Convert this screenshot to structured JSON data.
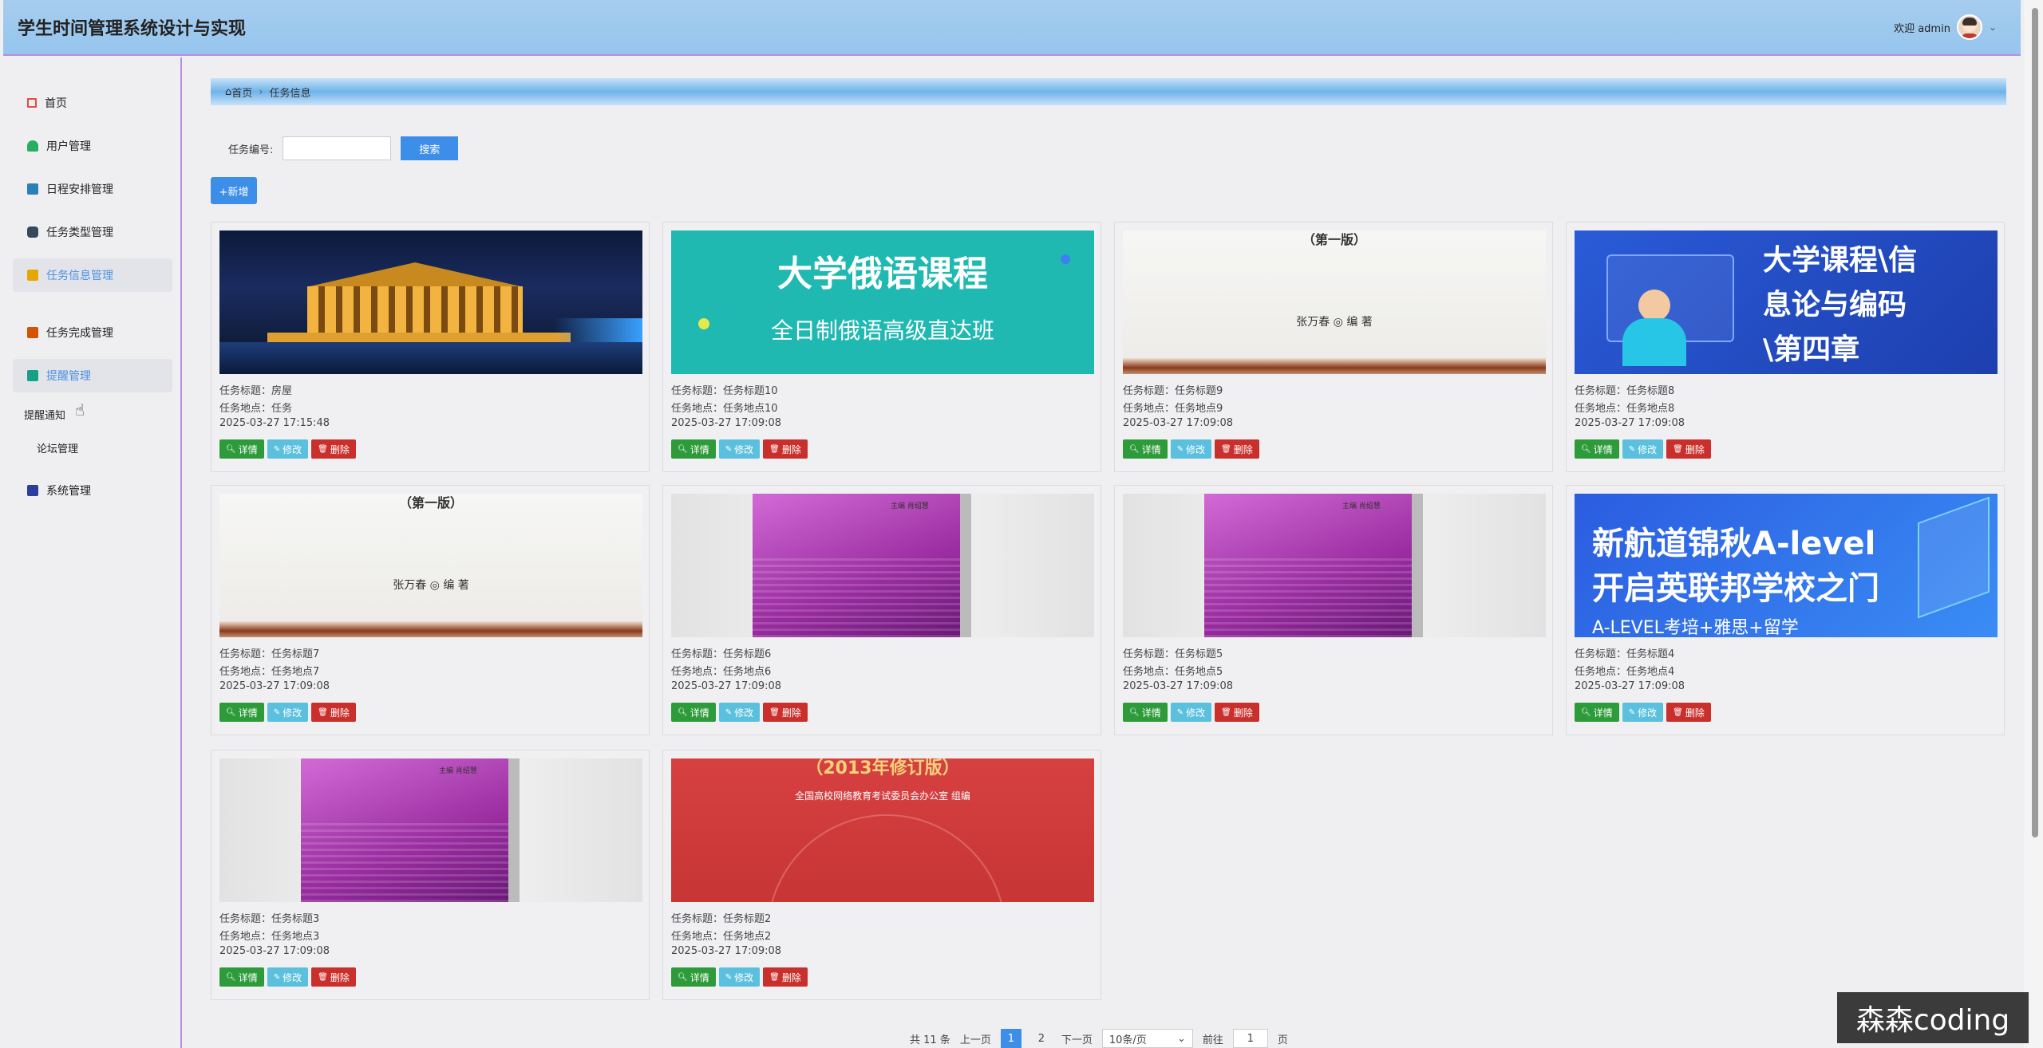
{
  "app": {
    "title": "学生时间管理系统设计与实现"
  },
  "user": {
    "greeting": "欢迎 admin"
  },
  "sidebar": {
    "items": [
      {
        "label": "首页",
        "icon": "home-icon",
        "color": "#e74c3c"
      },
      {
        "label": "用户管理",
        "icon": "user-icon",
        "color": "#27ae60"
      },
      {
        "label": "日程安排管理",
        "icon": "schedule-icon",
        "color": "#2980b9"
      },
      {
        "label": "任务类型管理",
        "icon": "type-icon",
        "color": "#34495e"
      },
      {
        "label": "任务信息管理",
        "icon": "info-icon",
        "color": "#e5a800"
      },
      {
        "label": "任务完成管理",
        "icon": "complete-icon",
        "color": "#d35400"
      },
      {
        "label": "提醒管理",
        "icon": "reminder-icon",
        "color": "#16a085"
      },
      {
        "label": "系统管理",
        "icon": "system-icon",
        "color": "#2c3e9b"
      }
    ],
    "sub_items": [
      "提醒通知",
      "论坛管理"
    ]
  },
  "breadcrumb": {
    "home": "首页",
    "current": "任务信息"
  },
  "search": {
    "label": "任务编号:",
    "button": "搜索"
  },
  "add_button": "新增",
  "card_labels": {
    "title_prefix": "任务标题：",
    "location_prefix": "任务地点：",
    "detail": "详情",
    "edit": "修改",
    "delete": "删除"
  },
  "cards": [
    {
      "title": "房屋",
      "location": "任务",
      "time": "2025-03-27 17:15:48",
      "image": "night-temple"
    },
    {
      "title": "任务标题10",
      "location": "任务地点10",
      "time": "2025-03-27 17:09:08",
      "image": "russian-course",
      "img_text1": "大学俄语课程",
      "img_text2": "全日制俄语高级直达班"
    },
    {
      "title": "任务标题9",
      "location": "任务地点9",
      "time": "2025-03-27 17:09:08",
      "image": "book-cover-white",
      "img_text1": "（第一版）",
      "img_text2": "张万春 ◎ 编 著"
    },
    {
      "title": "任务标题8",
      "location": "任务地点8",
      "time": "2025-03-27 17:09:08",
      "image": "coding-course",
      "img_text1": "大学课程\\信",
      "img_text2": "息论与编码",
      "img_text3": "\\第四章"
    },
    {
      "title": "任务标题7",
      "location": "任务地点7",
      "time": "2025-03-27 17:09:08",
      "image": "book-cover-white",
      "img_text1": "（第一版）",
      "img_text2": "张万春 ◎ 编 著"
    },
    {
      "title": "任务标题6",
      "location": "任务地点6",
      "time": "2025-03-27 17:09:08",
      "image": "purple-book",
      "img_text1": "主编 肖绍慧"
    },
    {
      "title": "任务标题5",
      "location": "任务地点5",
      "time": "2025-03-27 17:09:08",
      "image": "purple-book",
      "img_text1": "主编 肖绍慧"
    },
    {
      "title": "任务标题4",
      "location": "任务地点4",
      "time": "2025-03-27 17:09:08",
      "image": "alevel-ad",
      "img_text1": "新航道锦秋A-level",
      "img_text2": "开启英联邦学校之门",
      "img_text3": "A-LEVEL考培+雅思+留学"
    },
    {
      "title": "任务标题3",
      "location": "任务地点3",
      "time": "2025-03-27 17:09:08",
      "image": "purple-book",
      "img_text1": "主编 肖绍慧"
    },
    {
      "title": "任务标题2",
      "location": "任务地点2",
      "time": "2025-03-27 17:09:08",
      "image": "red-book",
      "img_text1": "（2013年修订版）",
      "img_text2": "全国高校网络教育考试委员会办公室  组编"
    }
  ],
  "pagination": {
    "total": "共 11 条",
    "prev": "上一页",
    "pages": [
      "1",
      "2"
    ],
    "next": "下一页",
    "page_size": "10条/页",
    "goto_label": "前往",
    "goto_value": "1",
    "page_unit": "页"
  },
  "watermark": "森森coding"
}
